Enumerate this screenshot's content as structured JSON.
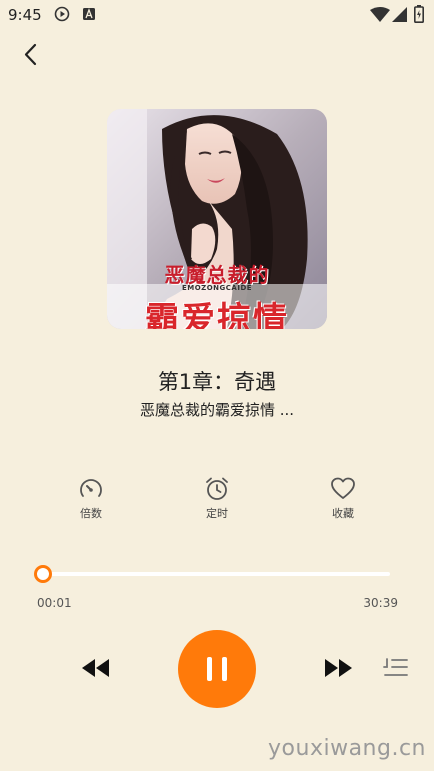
{
  "status": {
    "time": "9:45",
    "icons": [
      "play-circle-icon",
      "a-box-icon",
      "wifi-icon",
      "signal-icon",
      "battery-icon"
    ]
  },
  "cover": {
    "title_line1": "恶魔总裁的",
    "subtitle": "EMOZONGCAIDE",
    "title_line2": "霸爱掠情"
  },
  "chapter_title": "第1章：奇遇",
  "book_title": "恶魔总裁的霸爱掠情 ...",
  "actions": [
    {
      "label": "倍数",
      "icon": "speed-dial-icon"
    },
    {
      "label": "定时",
      "icon": "alarm-clock-icon"
    },
    {
      "label": "收藏",
      "icon": "heart-icon"
    }
  ],
  "progress": {
    "current": "00:01",
    "total": "30:39",
    "fraction": 0.0
  },
  "controls": {
    "rewind": "rewind-icon",
    "play_pause": "pause-icon",
    "forward": "fast-forward-icon",
    "playlist": "playlist-icon"
  },
  "watermark": "youxiwang.cn",
  "colors": {
    "background": "#f6efdd",
    "accent": "#ff7a0a"
  }
}
